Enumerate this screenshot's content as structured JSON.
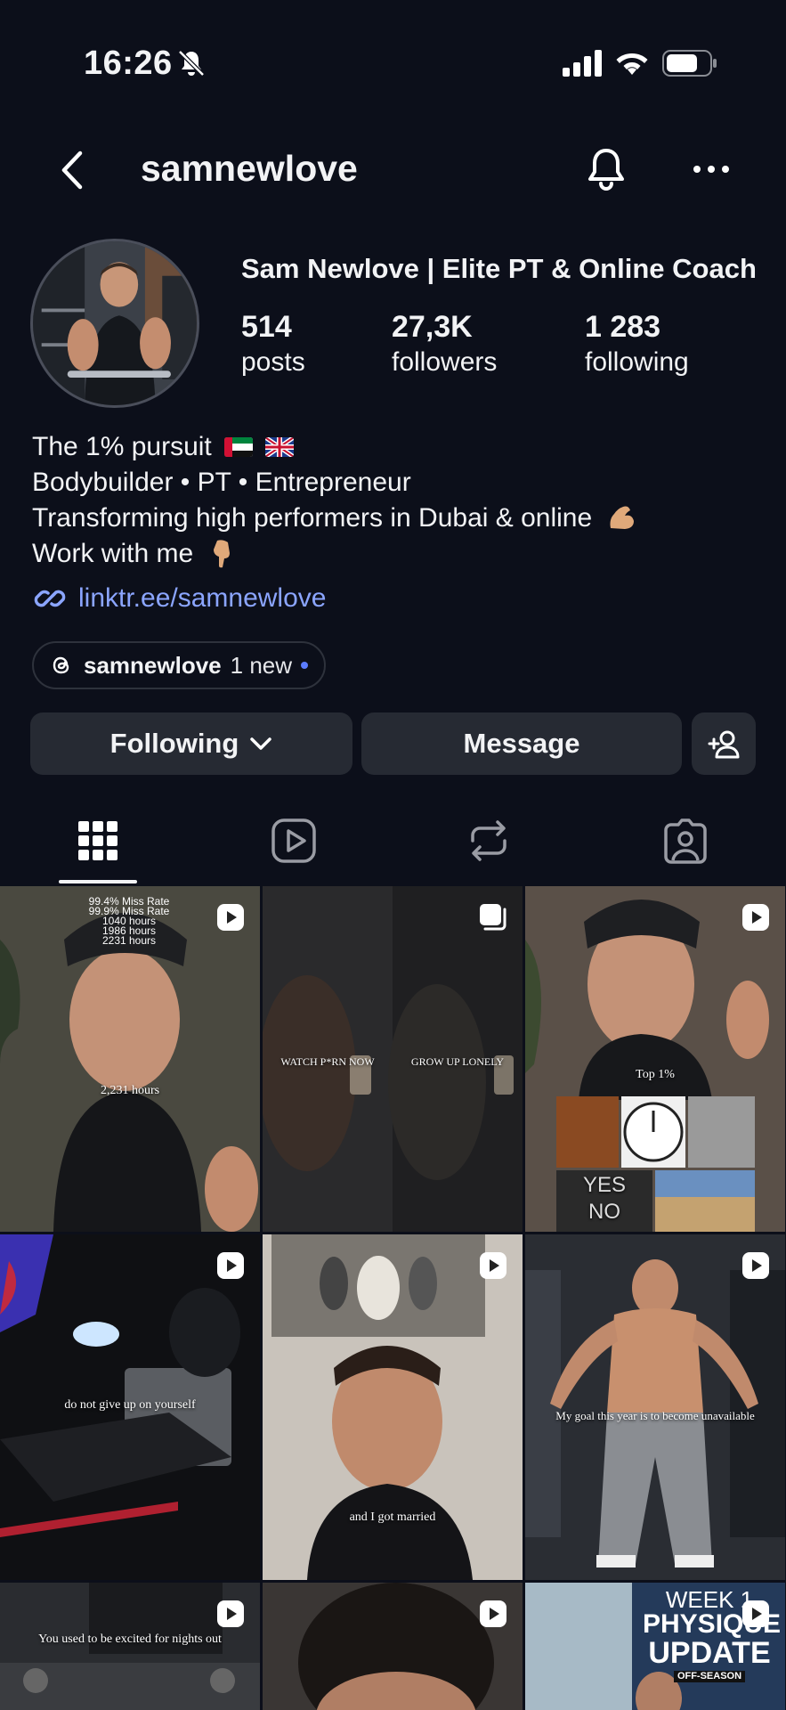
{
  "status_bar": {
    "time": "16:26"
  },
  "header": {
    "username": "samnewlove"
  },
  "profile": {
    "full_name": "Sam Newlove | Elite PT & Online Coach",
    "stats": [
      {
        "value": "514",
        "label": "posts"
      },
      {
        "value": "27,3K",
        "label": "followers"
      },
      {
        "value": "1 283",
        "label": "following"
      }
    ],
    "bio": [
      "The 1% pursuit",
      "Bodybuilder • PT • Entrepreneur",
      "Transforming high performers in Dubai & online",
      "Work with me"
    ],
    "link": "linktr.ee/samnewlove",
    "threads": {
      "name": "samnewlove",
      "badge": "1 new"
    }
  },
  "actions": {
    "following_label": "Following",
    "message_label": "Message"
  },
  "tabs": [
    {
      "name": "posts-grid",
      "icon": "grid-icon",
      "active": true
    },
    {
      "name": "reels",
      "icon": "reels-icon",
      "active": false
    },
    {
      "name": "reposts",
      "icon": "repost-icon",
      "active": false
    },
    {
      "name": "tagged",
      "icon": "tagged-icon",
      "active": false
    }
  ],
  "posts": [
    {
      "type": "reel",
      "overlay": "2,231 hours",
      "stats": [
        "99.4% Miss Rate",
        "99.9% Miss Rate",
        "1040 hours",
        "1986 hours",
        "2231 hours"
      ]
    },
    {
      "type": "carousel",
      "overlay_left": "WATCH P*RN NOW",
      "overlay_right": "GROW UP LONELY"
    },
    {
      "type": "reel",
      "overlay": "Top 1%",
      "collage": [
        "YES",
        "NO"
      ]
    },
    {
      "type": "reel",
      "overlay": "do not give up on yourself"
    },
    {
      "type": "reel",
      "overlay": "and I got married"
    },
    {
      "type": "reel",
      "overlay": "My goal this year is to become unavailable"
    },
    {
      "type": "reel",
      "overlay": "You used to be excited for nights out"
    },
    {
      "type": "reel",
      "overlay": ""
    },
    {
      "type": "reel",
      "week": [
        "WEEK 1",
        "PHYSIQUE",
        "UPDATE",
        "OFF-SEASON"
      ]
    }
  ],
  "colors": {
    "background": "#0c0f1a",
    "button": "#262a33",
    "link": "#8ba5ff",
    "accent_dot": "#5b7cff"
  }
}
